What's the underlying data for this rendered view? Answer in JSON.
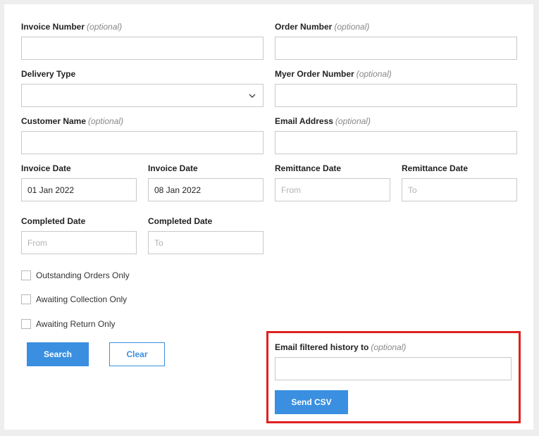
{
  "form": {
    "invoice_number": {
      "label": "Invoice Number",
      "optional": "(optional)",
      "value": ""
    },
    "order_number": {
      "label": "Order Number",
      "optional": "(optional)",
      "value": ""
    },
    "delivery_type": {
      "label": "Delivery Type",
      "value": ""
    },
    "myer_order_number": {
      "label": "Myer Order Number",
      "optional": "(optional)",
      "value": ""
    },
    "customer_name": {
      "label": "Customer Name",
      "optional": "(optional)",
      "value": ""
    },
    "email_address": {
      "label": "Email Address",
      "optional": "(optional)",
      "value": ""
    },
    "invoice_date_from": {
      "label": "Invoice Date",
      "value": "01 Jan 2022"
    },
    "invoice_date_to": {
      "label": "Invoice Date",
      "value": "08 Jan 2022"
    },
    "remittance_date_from": {
      "label": "Remittance Date",
      "placeholder": "From"
    },
    "remittance_date_to": {
      "label": "Remittance Date",
      "placeholder": "To"
    },
    "completed_date_from": {
      "label": "Completed Date",
      "placeholder": "From"
    },
    "completed_date_to": {
      "label": "Completed Date",
      "placeholder": "To"
    }
  },
  "checkboxes": [
    {
      "label": "Outstanding Orders Only",
      "checked": false
    },
    {
      "label": "Awaiting Collection Only",
      "checked": false
    },
    {
      "label": "Awaiting Return Only",
      "checked": false
    }
  ],
  "actions": {
    "search_label": "Search",
    "clear_label": "Clear"
  },
  "export": {
    "label": "Email filtered history to",
    "optional": "(optional)",
    "value": "",
    "send_label": "Send CSV"
  },
  "colors": {
    "accent": "#3a8fe0",
    "highlight": "#e02020",
    "border": "#c9c9c9",
    "background": "#eeeeee"
  },
  "icons": {
    "delivery_type_select": "chevron-down-icon"
  }
}
